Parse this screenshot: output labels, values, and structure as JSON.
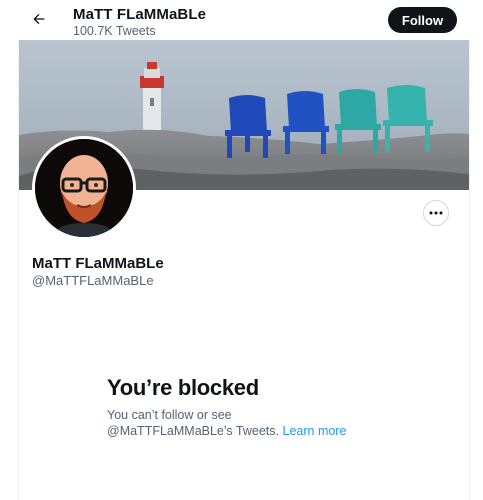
{
  "header": {
    "name": "MaTT FLaMMaBLe",
    "tweet_count": "100.7K Tweets",
    "follow_label": "Follow"
  },
  "profile": {
    "name": "MaTT FLaMMaBLe",
    "handle": "@MaTTFLaMMaBLe"
  },
  "blocked": {
    "title": "You’re blocked",
    "line1": "You can’t follow or see",
    "line2_prefix": "@MaTTFLaMMaBLe’s Tweets.",
    "learn_more": "Learn more"
  },
  "icons": {
    "back": "back-arrow-icon",
    "more": "more-options-icon"
  },
  "colors": {
    "text": "#0f1419",
    "secondary": "#536471",
    "link": "#1d9bf0",
    "button": "#0f1419"
  }
}
